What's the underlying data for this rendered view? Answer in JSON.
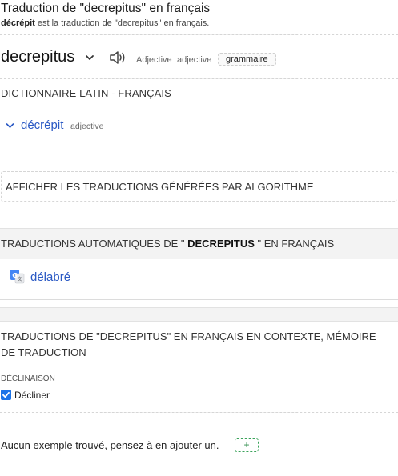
{
  "header": {
    "title": "Traduction de \"decrepitus\" en français",
    "subtitle_bold": "décrépit",
    "subtitle_rest": " est la traduction de \"decrepitus\" en français."
  },
  "headword": {
    "word": "decrepitus",
    "chevron_icon": "chevron-down-icon",
    "speaker_icon": "speaker-icon",
    "pos_label": "Adjective",
    "pos_label_fr": "adjective",
    "grammar_chip": "grammaire"
  },
  "dictionary": {
    "title": "DICTIONNAIRE LATIN - FRANÇAIS",
    "entries": [
      {
        "word": "décrépit",
        "pos": "adjective"
      }
    ]
  },
  "algo": {
    "label": "AFFICHER LES TRADUCTIONS GÉNÉRÉES PAR ALGORITHME"
  },
  "auto": {
    "title_prefix": "TRADUCTIONS AUTOMATIQUES DE \" ",
    "title_word": "DECREPITUS",
    "title_suffix": " \" EN FRANÇAIS",
    "icon": "google-translate-icon",
    "translations": [
      {
        "word": "délabré"
      }
    ]
  },
  "context": {
    "title": "TRADUCTIONS DE \"DECREPITUS\" EN FRANÇAIS EN CONTEXTE, MÉMOIRE DE TRADUCTION",
    "declension_label": "DÉCLINAISON",
    "decline_checkbox_label": "Décliner",
    "decline_checked": true,
    "no_example_text": "Aucun exemple trouvé, pensez à en ajouter un.",
    "add_button_label": "+"
  },
  "colors": {
    "link": "#2a59c4",
    "checkbox": "#1a73e8",
    "add_button": "#2c8c4a"
  }
}
